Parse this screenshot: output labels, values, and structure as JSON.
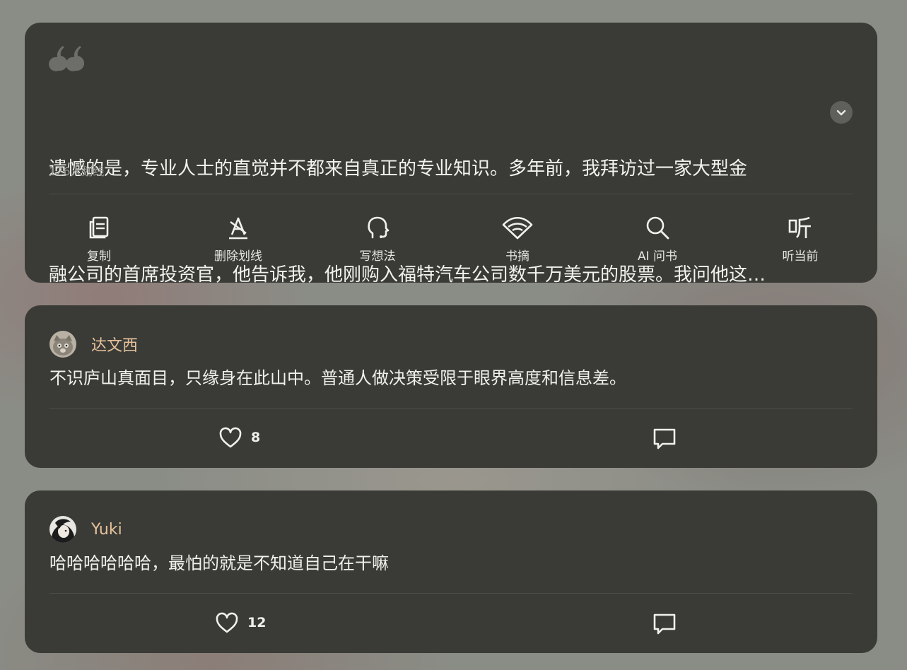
{
  "quote": {
    "lines": [
      "遗憾的是，专业人士的直觉并不都来自真正的专业知识。多年前，我拜访过一家大型金",
      "融公司的首席投资官，他告诉我，他刚购入福特汽车公司数千万美元的股票。我问他这…"
    ],
    "underline_count": "126人划线",
    "actions": [
      {
        "label": "复制",
        "icon": "copy-icon"
      },
      {
        "label": "删除划线",
        "icon": "erase-underline-icon"
      },
      {
        "label": "写想法",
        "icon": "thought-icon"
      },
      {
        "label": "书摘",
        "icon": "excerpt-fan-icon"
      },
      {
        "label": "AI 问书",
        "icon": "search-icon"
      },
      {
        "label": "听当前",
        "icon": "listen-icon"
      }
    ]
  },
  "comments": [
    {
      "user": "达文西",
      "avatar": "cat-avatar",
      "text": "不识庐山真面目，只缘身在此山中。普通人做决策受限于眼界高度和信息差。",
      "likes": "8"
    },
    {
      "user": "Yuki",
      "avatar": "anime-avatar",
      "text": "哈哈哈哈哈哈，最怕的就是不知道自己在干嘛",
      "likes": "12"
    }
  ],
  "colors": {
    "card": "#3a3b37",
    "username": "#e6c29a",
    "text": "#f0f0ec"
  }
}
